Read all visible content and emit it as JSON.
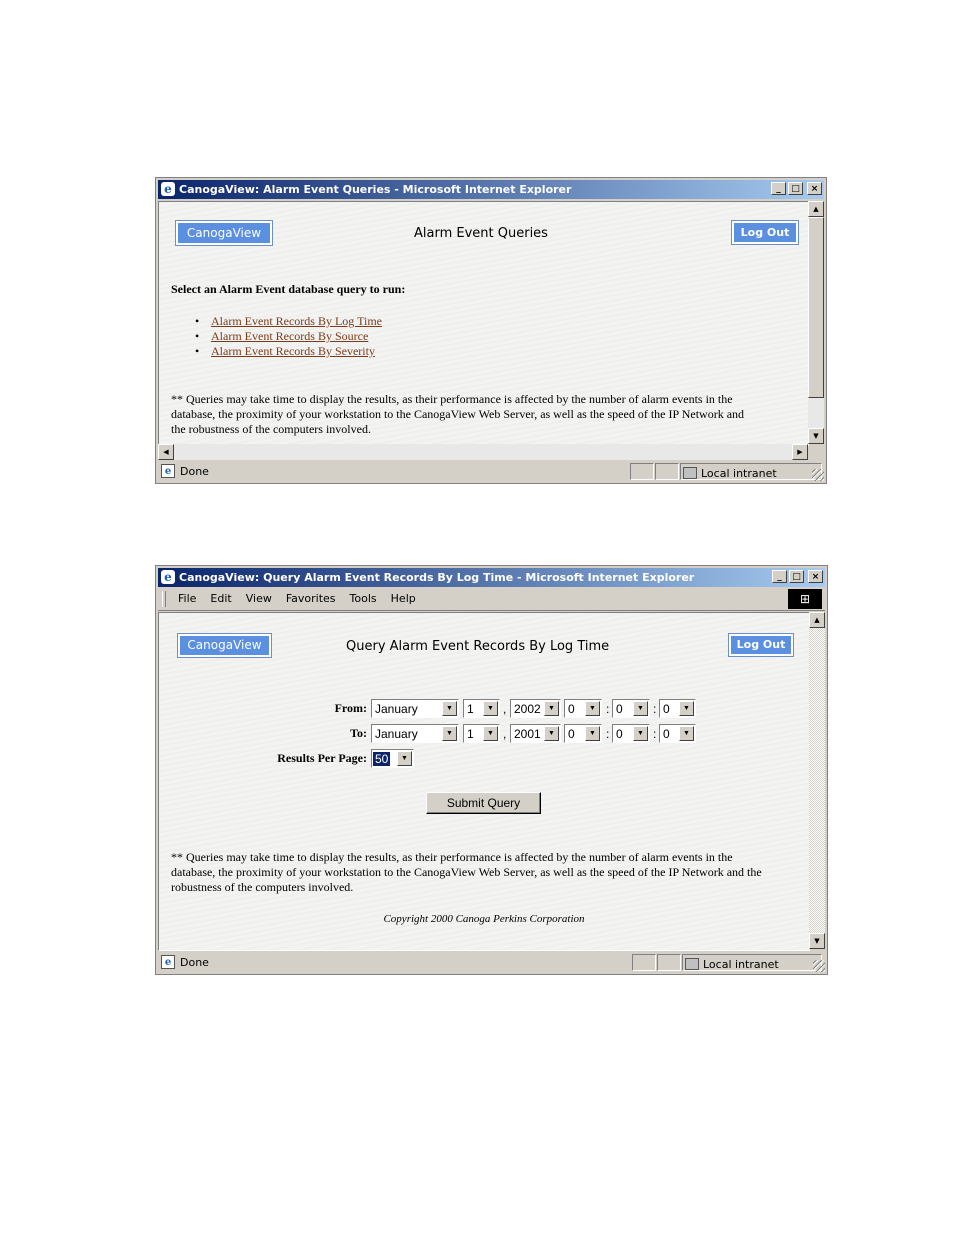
{
  "window1": {
    "title": "CanogaView: Alarm Event Queries - Microsoft Internet Explorer",
    "logo_label": "CanogaView",
    "heading": "Alarm Event Queries",
    "logout_label": "Log Out",
    "prompt": "Select an Alarm Event database query to run:",
    "links": [
      "Alarm Event Records By Log Time",
      "Alarm Event Records By Source",
      "Alarm Event Records By Severity"
    ],
    "note_lines": [
      "** Queries may take time to display the results, as their performance is affected by the number of alarm events in the",
      "database, the proximity of your workstation to the CanogaView Web Server, as well as the speed of the IP Network and",
      "the robustness of the computers involved."
    ],
    "status": "Done",
    "zone": "Local intranet"
  },
  "window2": {
    "title": "CanogaView: Query Alarm Event Records By Log Time - Microsoft Internet Explorer",
    "menu": [
      "File",
      "Edit",
      "View",
      "Favorites",
      "Tools",
      "Help"
    ],
    "logo_label": "CanogaView",
    "heading": "Query Alarm Event Records By Log Time",
    "logout_label": "Log Out",
    "from_label": "From:",
    "to_label": "To:",
    "from": {
      "month": "January",
      "day": "1",
      "year": "2002",
      "hour": "0",
      "minute": "0",
      "second": "0"
    },
    "to": {
      "month": "January",
      "day": "1",
      "year": "2001",
      "hour": "0",
      "minute": "0",
      "second": "0"
    },
    "results_label": "Results Per Page:",
    "results_value": "50",
    "submit_label": "Submit Query",
    "note_lines": [
      "** Queries may take time to display the results, as their performance is affected by the number of alarm events in the",
      "database, the proximity of your workstation to the CanogaView Web Server, as well as the speed of the IP Network and the",
      "robustness of the computers involved."
    ],
    "copyright": "Copyright 2000 Canoga Perkins Corporation",
    "status": "Done",
    "zone": "Local intranet"
  },
  "separators": {
    "comma": ",",
    "colon": ":"
  },
  "icons": {
    "minimize": "_",
    "maximize": "□",
    "close": "×",
    "up": "▲",
    "down": "▼",
    "left": "◀",
    "right": "▶",
    "ie": "e"
  }
}
